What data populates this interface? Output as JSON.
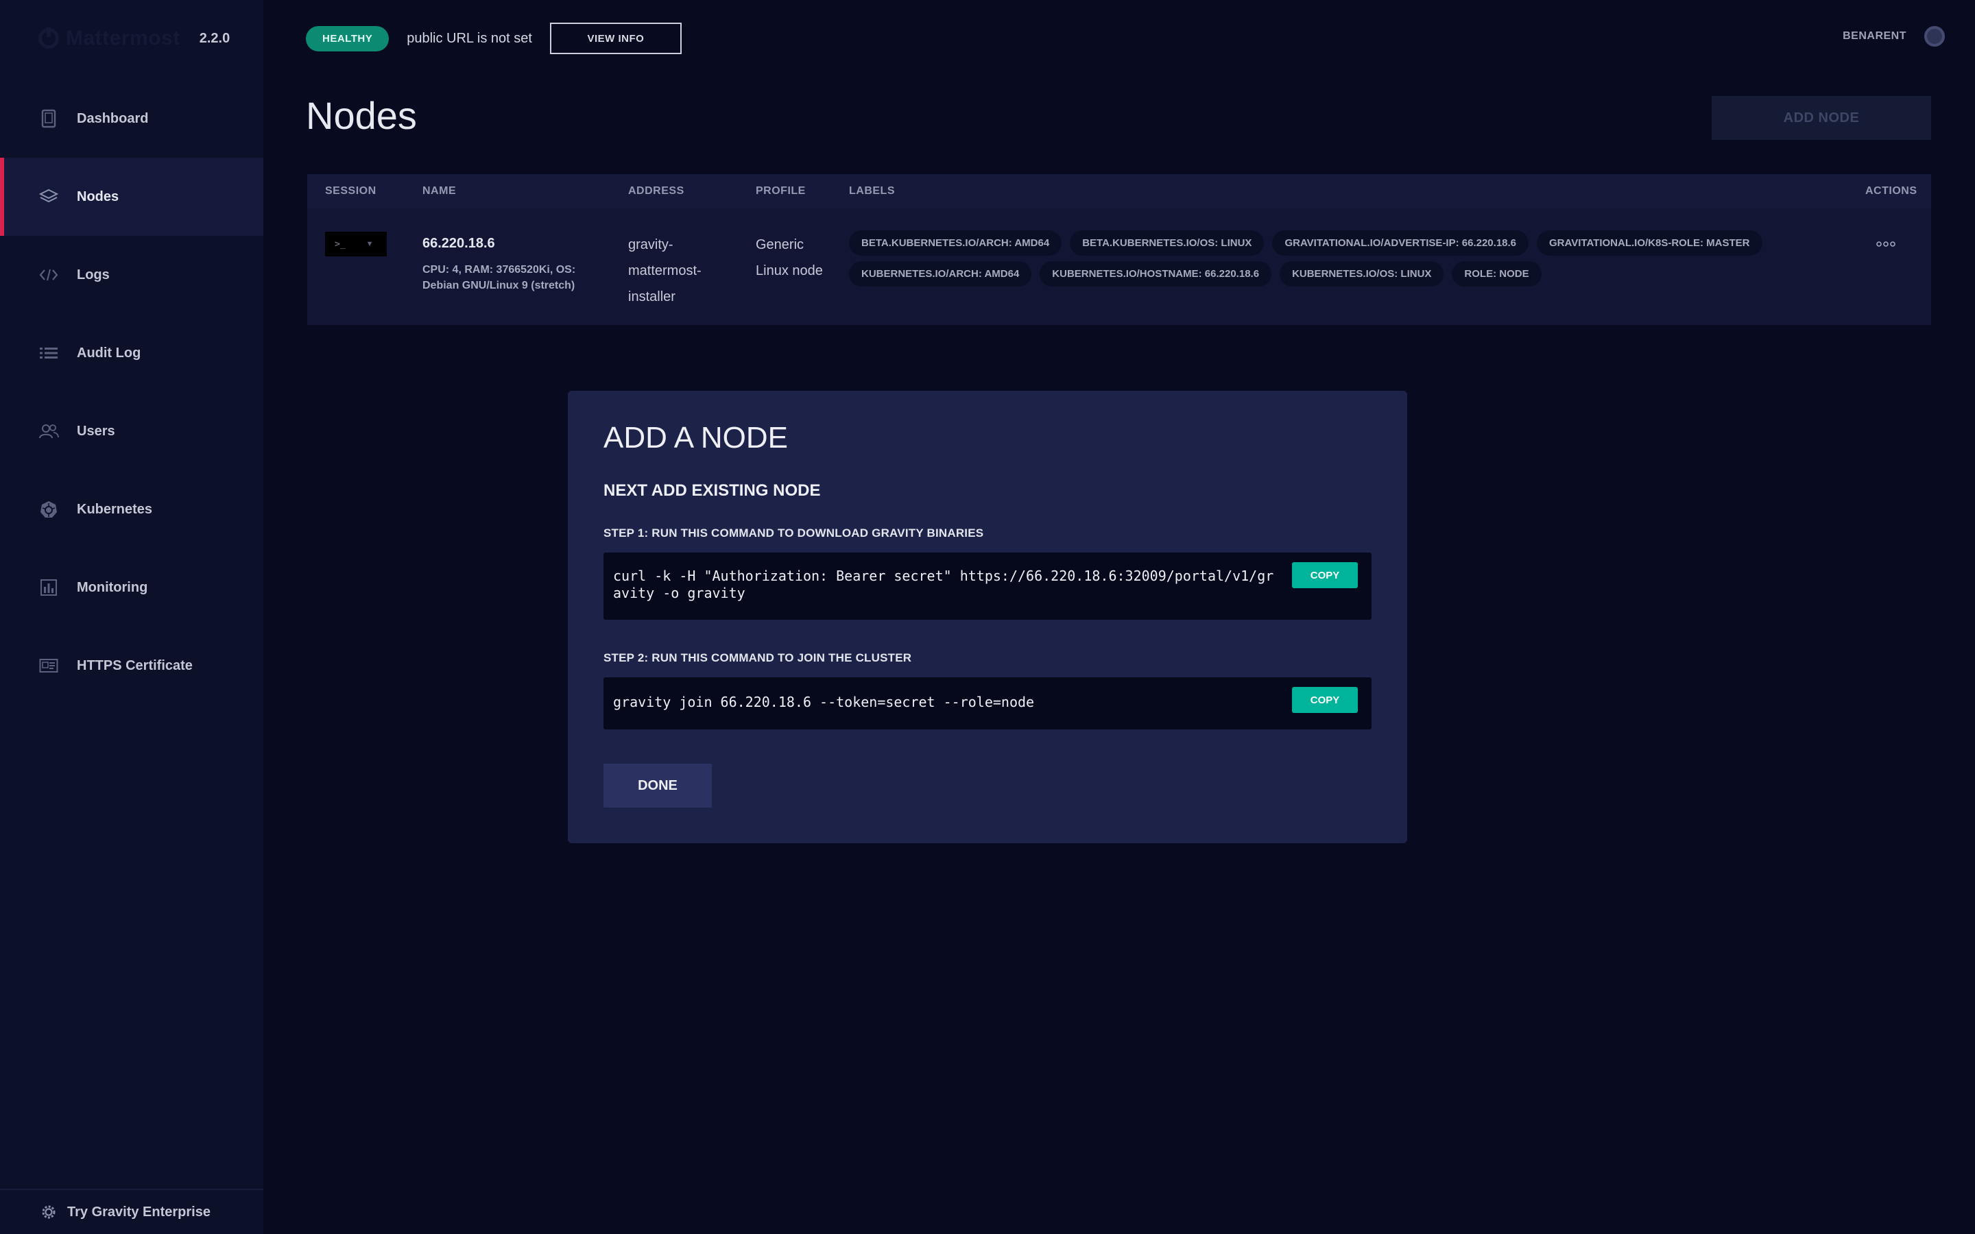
{
  "brand": {
    "name": "Mattermost",
    "version": "2.2.0",
    "logo_icon": "mattermost-logo-icon"
  },
  "sidebar": {
    "items": [
      {
        "label": "Dashboard",
        "icon": "tablet-icon",
        "active": false
      },
      {
        "label": "Nodes",
        "icon": "layers-icon",
        "active": true
      },
      {
        "label": "Logs",
        "icon": "code-icon",
        "active": false
      },
      {
        "label": "Audit Log",
        "icon": "list-icon",
        "active": false
      },
      {
        "label": "Users",
        "icon": "users-icon",
        "active": false
      },
      {
        "label": "Kubernetes",
        "icon": "kubernetes-icon",
        "active": false
      },
      {
        "label": "Monitoring",
        "icon": "bar-chart-icon",
        "active": false
      },
      {
        "label": "HTTPS Certificate",
        "icon": "certificate-icon",
        "active": false
      }
    ],
    "footer": {
      "label": "Try Gravity Enterprise",
      "icon": "gear-icon"
    }
  },
  "topbar": {
    "status": "HEALTHY",
    "public_url_text": "public URL is not set",
    "view_info_label": "VIEW INFO",
    "user": "BENARENT"
  },
  "page": {
    "title": "Nodes",
    "add_node_label": "ADD NODE"
  },
  "table": {
    "headers": {
      "session": "SESSION",
      "name": "NAME",
      "address": "ADDRESS",
      "profile": "PROFILE",
      "labels": "LABELS",
      "actions": "ACTIONS"
    },
    "rows": [
      {
        "session_prompt": ">_",
        "name": "66.220.18.6",
        "detail": "CPU: 4, RAM: 3766520Ki, OS: Debian GNU/Linux 9 (stretch)",
        "address": "gravity-mattermost-installer",
        "profile": "Generic Linux node",
        "labels": [
          "BETA.KUBERNETES.IO/ARCH: AMD64",
          "BETA.KUBERNETES.IO/OS: LINUX",
          "GRAVITATIONAL.IO/ADVERTISE-IP: 66.220.18.6",
          "GRAVITATIONAL.IO/K8S-ROLE: MASTER",
          "KUBERNETES.IO/ARCH: AMD64",
          "KUBERNETES.IO/HOSTNAME: 66.220.18.6",
          "KUBERNETES.IO/OS: LINUX",
          "ROLE: NODE"
        ]
      }
    ]
  },
  "modal": {
    "title": "ADD A NODE",
    "subtitle": "NEXT ADD EXISTING NODE",
    "step1_title": "STEP 1: RUN THIS COMMAND TO DOWNLOAD GRAVITY BINARIES",
    "step1_command": "curl -k -H \"Authorization: Bearer secret\" https://66.220.18.6:32009/portal/v1/gravity -o gravity",
    "step2_title": "STEP 2: RUN THIS COMMAND TO JOIN THE CLUSTER",
    "step2_command": "gravity join 66.220.18.6 --token=secret --role=node",
    "copy_label": "COPY",
    "done_label": "DONE"
  },
  "colors": {
    "background": "#080b1f",
    "sidebar": "#0c1028",
    "accent_active": "#d8234f",
    "healthy": "#0c8a72",
    "copy_button": "#00b39b",
    "modal": "#1d2249"
  }
}
